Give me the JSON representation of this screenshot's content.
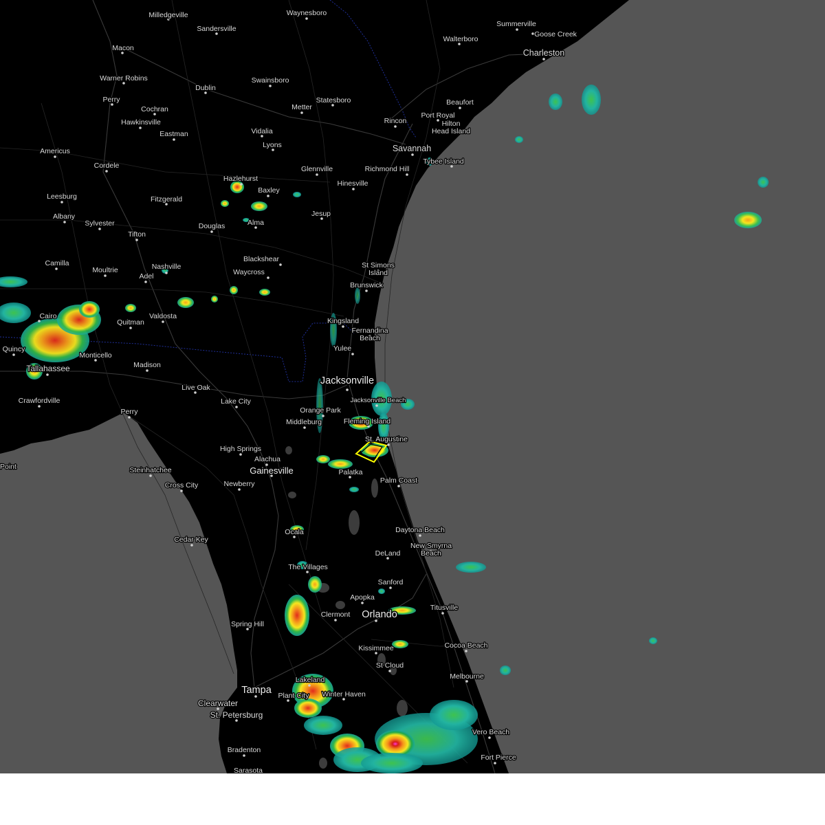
{
  "map": {
    "ocean_color": "#555555",
    "land_color": "#000000",
    "warning_polygon_color": "#ffff00",
    "cities": [
      {
        "name": "Milledgeville",
        "major": false
      },
      {
        "name": "Waynesboro",
        "major": false
      },
      {
        "name": "Summerville",
        "major": false
      },
      {
        "name": "Goose Creek",
        "major": false
      },
      {
        "name": "Sandersville",
        "major": false
      },
      {
        "name": "Macon",
        "major": false
      },
      {
        "name": "Walterboro",
        "major": false
      },
      {
        "name": "Charleston",
        "major": false
      },
      {
        "name": "Warner Robins",
        "major": false
      },
      {
        "name": "Swainsboro",
        "major": false
      },
      {
        "name": "Dublin",
        "major": false
      },
      {
        "name": "Perry",
        "major": false
      },
      {
        "name": "Statesboro",
        "major": false
      },
      {
        "name": "Beaufort",
        "major": false
      },
      {
        "name": "Metter",
        "major": false
      },
      {
        "name": "Cochran",
        "major": false
      },
      {
        "name": "Port Royal",
        "major": false
      },
      {
        "name": "Hilton",
        "major": false
      },
      {
        "name": "Head Island",
        "major": false
      },
      {
        "name": "Hawkinsville",
        "major": false
      },
      {
        "name": "Rincon",
        "major": false
      },
      {
        "name": "Vidalia",
        "major": false
      },
      {
        "name": "Eastman",
        "major": false
      },
      {
        "name": "Lyons",
        "major": false
      },
      {
        "name": "Savannah",
        "major": false
      },
      {
        "name": "Americus",
        "major": false
      },
      {
        "name": "Tybee Island",
        "major": false
      },
      {
        "name": "Cordele",
        "major": false
      },
      {
        "name": "Glennville",
        "major": false
      },
      {
        "name": "Richmond Hill",
        "major": false
      },
      {
        "name": "Hazlehurst",
        "major": false
      },
      {
        "name": "Hinesville",
        "major": false
      },
      {
        "name": "Baxley",
        "major": false
      },
      {
        "name": "Leesburg",
        "major": false
      },
      {
        "name": "Fitzgerald",
        "major": false
      },
      {
        "name": "Albany",
        "major": false
      },
      {
        "name": "Alma",
        "major": false
      },
      {
        "name": "Douglas",
        "major": false
      },
      {
        "name": "Jesup",
        "major": false
      },
      {
        "name": "Sylvester",
        "major": false
      },
      {
        "name": "Tifton",
        "major": false
      },
      {
        "name": "Blackshear",
        "major": false
      },
      {
        "name": "Camilla",
        "major": false
      },
      {
        "name": "St Simons",
        "major": false
      },
      {
        "name": "Nashville",
        "major": false
      },
      {
        "name": "Island",
        "major": false
      },
      {
        "name": "Moultrie",
        "major": false
      },
      {
        "name": "Waycross",
        "major": false
      },
      {
        "name": "Adel",
        "major": false
      },
      {
        "name": "Brunswick",
        "major": false
      },
      {
        "name": "Cairo",
        "major": false
      },
      {
        "name": "Valdosta",
        "major": false
      },
      {
        "name": "Kingsland",
        "major": false
      },
      {
        "name": "Quitman",
        "major": false
      },
      {
        "name": "Fernandina",
        "major": false
      },
      {
        "name": "Beach",
        "major": false
      },
      {
        "name": "Quincy",
        "major": false
      },
      {
        "name": "Monticello",
        "major": false
      },
      {
        "name": "Yulee",
        "major": false
      },
      {
        "name": "Tallahassee",
        "major": false
      },
      {
        "name": "Madison",
        "major": false
      },
      {
        "name": "Jacksonville",
        "major": true
      },
      {
        "name": "Live Oak",
        "major": false
      },
      {
        "name": "Jacksonville Beach",
        "major": false
      },
      {
        "name": "Crawfordville",
        "major": false
      },
      {
        "name": "Lake City",
        "major": false
      },
      {
        "name": "Orange Park",
        "major": false
      },
      {
        "name": "Fleming Island",
        "major": false
      },
      {
        "name": "Perry",
        "major": false
      },
      {
        "name": "Middleburg",
        "major": false
      },
      {
        "name": "St. Augustine",
        "major": false
      },
      {
        "name": "High Springs",
        "major": false
      },
      {
        "name": "Alachua",
        "major": false
      },
      {
        "name": "Steinhatchee",
        "major": false
      },
      {
        "name": "Gainesville",
        "major": true
      },
      {
        "name": "Palatka",
        "major": false
      },
      {
        "name": "Palm Coast",
        "major": false
      },
      {
        "name": "Cross City",
        "major": false
      },
      {
        "name": "Newberry",
        "major": false
      },
      {
        "name": "Daytona Beach",
        "major": false
      },
      {
        "name": "Ocala",
        "major": false
      },
      {
        "name": "Cedar Key",
        "major": false
      },
      {
        "name": "New Smyrna",
        "major": false
      },
      {
        "name": "Beach",
        "major": false
      },
      {
        "name": "DeLand",
        "major": false
      },
      {
        "name": "The Villages",
        "major": false
      },
      {
        "name": "Sanford",
        "major": false
      },
      {
        "name": "Apopka",
        "major": false
      },
      {
        "name": "Titusville",
        "major": false
      },
      {
        "name": "Clermont",
        "major": false
      },
      {
        "name": "Orlando",
        "major": true
      },
      {
        "name": "Spring Hill",
        "major": false
      },
      {
        "name": "Kissimmee",
        "major": false
      },
      {
        "name": "Cocoa Beach",
        "major": false
      },
      {
        "name": "St Cloud",
        "major": false
      },
      {
        "name": "Melbourne",
        "major": false
      },
      {
        "name": "Lakeland",
        "major": false
      },
      {
        "name": "Tampa",
        "major": true
      },
      {
        "name": "Plant City",
        "major": false
      },
      {
        "name": "Winter Haven",
        "major": false
      },
      {
        "name": "Clearwater",
        "major": false
      },
      {
        "name": "St. Petersburg",
        "major": false
      },
      {
        "name": "Vero Beach",
        "major": false
      },
      {
        "name": "Bradenton",
        "major": false
      },
      {
        "name": "Fort Pierce",
        "major": false
      },
      {
        "name": "Sarasota",
        "major": false
      },
      {
        "name": "Point",
        "major": false
      }
    ]
  }
}
